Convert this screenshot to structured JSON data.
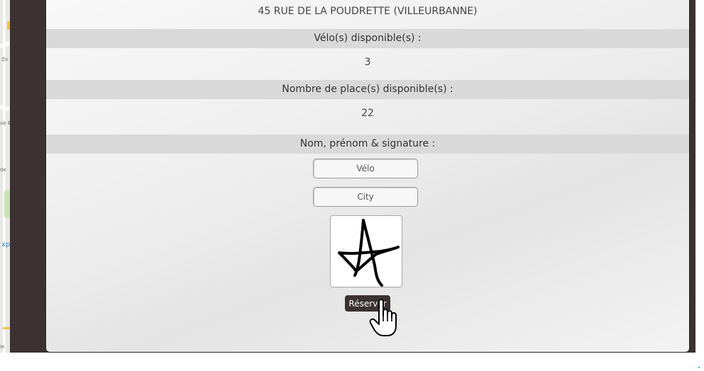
{
  "map": {
    "labels": [
      "Zo",
      "ue B",
      "de",
      "xp",
      "ie"
    ]
  },
  "station": {
    "address": "45 RUE DE LA POUDRETTE (VILLEURBANNE)",
    "bikes_label": "Vélo(s) disponible(s) :",
    "bikes_value": "3",
    "places_label": "Nombre de place(s) disponible(s) :",
    "places_value": "22"
  },
  "form": {
    "signature_label": "Nom, prénom & signature :",
    "lastname_placeholder": "Vélo",
    "firstname_placeholder": "City",
    "submit_label": "Réserver"
  },
  "colors": {
    "frame": "#3b3231",
    "header_band": "#d9d9d9",
    "button": "#3b3231"
  },
  "icons": [
    "signature-canvas",
    "hand-pointer-icon"
  ]
}
